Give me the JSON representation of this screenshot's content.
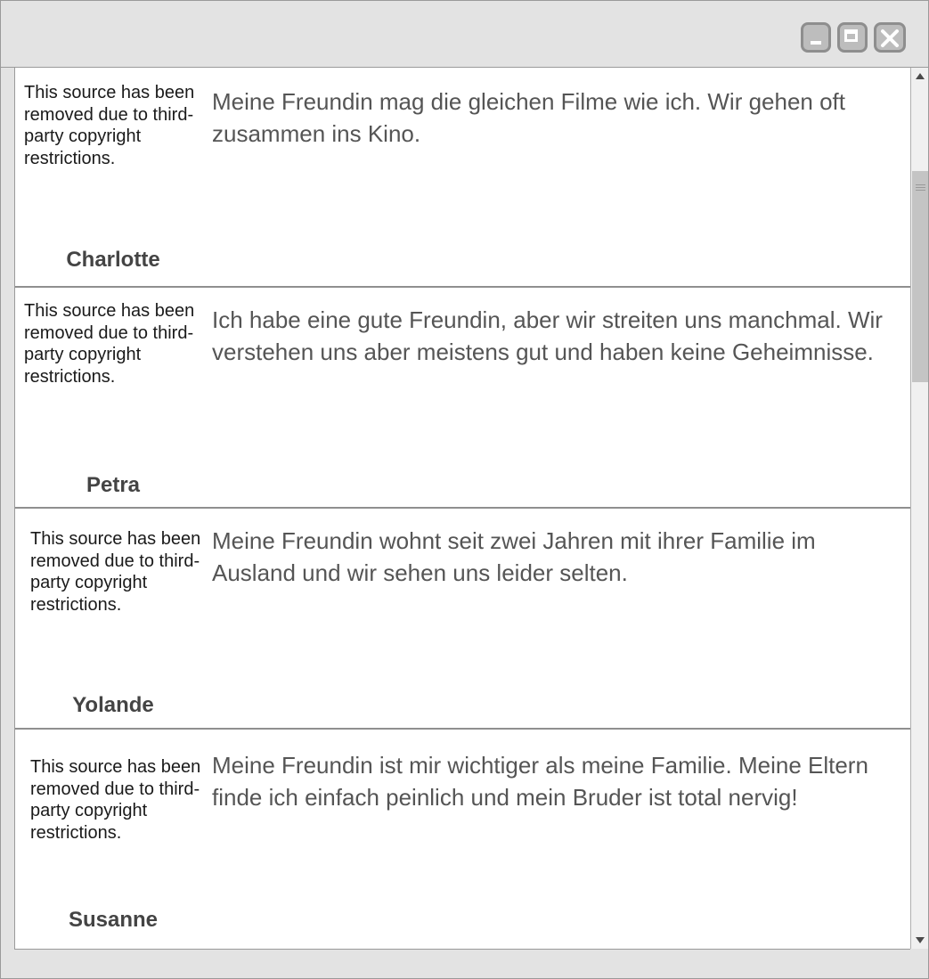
{
  "window": {
    "buttons": {
      "minimize_icon": "minimize-icon",
      "maximize_icon": "maximize-icon",
      "close_icon": "close-icon"
    }
  },
  "entries": [
    {
      "source_notice": "This source has been removed due to third-party copyright restrictions.",
      "name": "Charlotte",
      "quote": "Meine Freundin mag die gleichen Filme wie ich. Wir gehen oft zusammen ins Kino."
    },
    {
      "source_notice": "This source has been removed due to third-party copyright restrictions.",
      "name": "Petra",
      "quote": "Ich habe eine gute Freundin, aber wir streiten uns manchmal. Wir verstehen uns aber meistens gut und haben keine Geheimnisse."
    },
    {
      "source_notice": "This source has been removed due to third-party copyright restrictions.",
      "name": "Yolande",
      "quote": "Meine Freundin wohnt seit zwei Jahren mit ihrer Familie im Ausland und wir sehen uns leider selten."
    },
    {
      "source_notice": "This source has been removed due to third-party copyright restrictions.",
      "name": "Susanne",
      "quote": "Meine Freundin ist mir wichtiger als meine Familie. Meine Eltern finde ich einfach peinlich und mein Bruder ist total nervig!"
    }
  ],
  "colors": {
    "chrome": "#e3e3e3",
    "border": "#9a9a9a",
    "button_face": "#bdbdbd",
    "name_text": "#444444",
    "quote_text": "#555555"
  }
}
